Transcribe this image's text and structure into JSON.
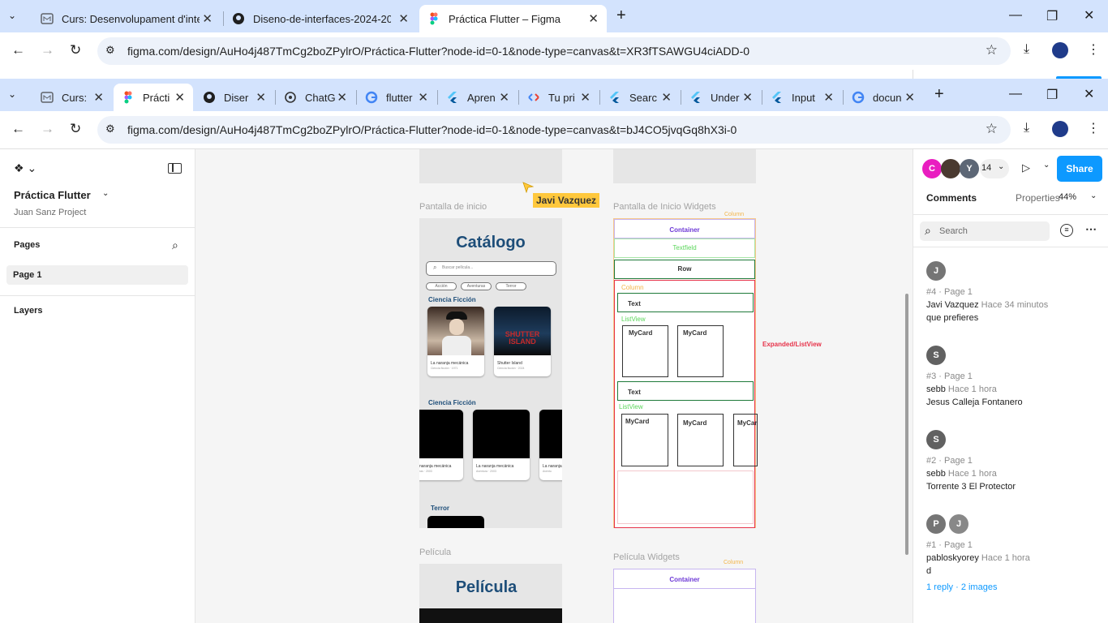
{
  "outer": {
    "tabs": [
      {
        "label": "Curs: Desenvolupament d'interf",
        "favicon": "moodle-icon"
      },
      {
        "label": "Diseno-de-interfaces-2024-202",
        "favicon": "github-icon"
      },
      {
        "label": "Práctica Flutter – Figma",
        "favicon": "figma-icon"
      }
    ],
    "url": "figma.com/design/AuHo4j487TmCg2boZPylrO/Práctica-Flutter?node-id=0-1&node-type=canvas&t=XR3fTSAWGU4ciADD-0"
  },
  "inner": {
    "tabs": [
      {
        "label": "Curs:",
        "favicon": "moodle-icon"
      },
      {
        "label": "Prácti",
        "favicon": "figma-icon"
      },
      {
        "label": "Diser",
        "favicon": "github-icon"
      },
      {
        "label": "ChatG",
        "favicon": "chatgpt-icon"
      },
      {
        "label": "flutter",
        "favicon": "google-icon"
      },
      {
        "label": "Apren",
        "favicon": "flutter-icon"
      },
      {
        "label": "Tu pri",
        "favicon": "codelab-icon"
      },
      {
        "label": "Searc",
        "favicon": "flutter-icon"
      },
      {
        "label": "Under",
        "favicon": "flutter-icon"
      },
      {
        "label": "Input",
        "favicon": "flutter-icon"
      },
      {
        "label": "docun",
        "favicon": "google-icon"
      }
    ],
    "url": "figma.com/design/AuHo4j487TmCg2boZPylrO/Práctica-Flutter?node-id=0-1&node-type=canvas&t=bJ4CO5jvqGq8hX3i-0"
  },
  "figma": {
    "file_name": "Práctica Flutter",
    "project": "Juan Sanz Project",
    "pages_label": "Pages",
    "page_item": "Page 1",
    "layers_label": "Layers",
    "cursor_user": "Javi Vazquez",
    "canvas": {
      "home_label": "Pantalla de inicio",
      "home_widgets_label": "Pantalla de Inicio Widgets",
      "pelicula_label": "Película",
      "pelicula_widgets_label": "Película Widgets",
      "catalog_title": "Catálogo",
      "search_placeholder": "Buscar película...",
      "chips": [
        "Acción",
        "Aventuras",
        "Terror"
      ],
      "section1": "Ciencia Ficción",
      "section2": "Ciencia Ficción",
      "section3": "Terror",
      "card1_title": "La naranja mecánica",
      "card1_sub": "Ciencia ficción · 1971",
      "card2_title": "Shutter Island",
      "card2_sub": "Ciencia ficción · 2024",
      "poster2_text": "SHUTTER ISLAND",
      "row2_titles": [
        "naranja mecánica",
        "La naranja mecánica",
        "La naranja"
      ],
      "row2_subs": [
        "ras · 2003",
        "Aventura · 2003",
        "Aventu"
      ],
      "pelicula_title": "Película",
      "w_column": "Column",
      "w_container": "Container",
      "w_textfield": "Textfield",
      "w_row": "Row",
      "w_column_inner": "Column",
      "w_text": "Text",
      "w_listview": "ListView",
      "w_mycard": "MyCard",
      "w_text2": "Text",
      "w_listview2": "ListView",
      "w_expanded": "Expanded/ListView",
      "w_column_bottom": "Column",
      "w_container_bottom": "Container"
    },
    "right": {
      "avatars": [
        "C",
        "",
        "Y"
      ],
      "viewer_count": "14",
      "share": "Share",
      "tabs": [
        "Comments",
        "Properties"
      ],
      "zoom": "44%",
      "search_placeholder": "Search",
      "comments": [
        {
          "avatar": "J",
          "meta": "#4 · Page 1",
          "user": "Javi Vazquez",
          "time": "Hace 34 minutos",
          "text": "que prefieres"
        },
        {
          "avatar": "S",
          "meta": "#3 · Page 1",
          "user": "sebb",
          "time": "Hace 1 hora",
          "text": "Jesus Calleja Fontanero"
        },
        {
          "avatar": "S",
          "meta": "#2 · Page 1",
          "user": "sebb",
          "time": "Hace 1 hora",
          "text": "Torrente 3 El Protector"
        },
        {
          "avatar": "P",
          "avatar2": "J",
          "meta": "#1 · Page 1",
          "user": "pabloskyorey",
          "time": "Hace 1 hora",
          "text": "d",
          "reply": "1 reply",
          "images": "2 images"
        }
      ]
    }
  },
  "colors": {
    "tab_bg": "#d3e3fd",
    "share_blue": "#0d99ff",
    "catalog_blue": "#1e4e79",
    "widget_purple": "#6e3ad6",
    "widget_green": "#5bd65b",
    "widget_orange": "#f3b548",
    "widget_red": "#e7334a",
    "cursor_yellow": "#ffc83d"
  }
}
